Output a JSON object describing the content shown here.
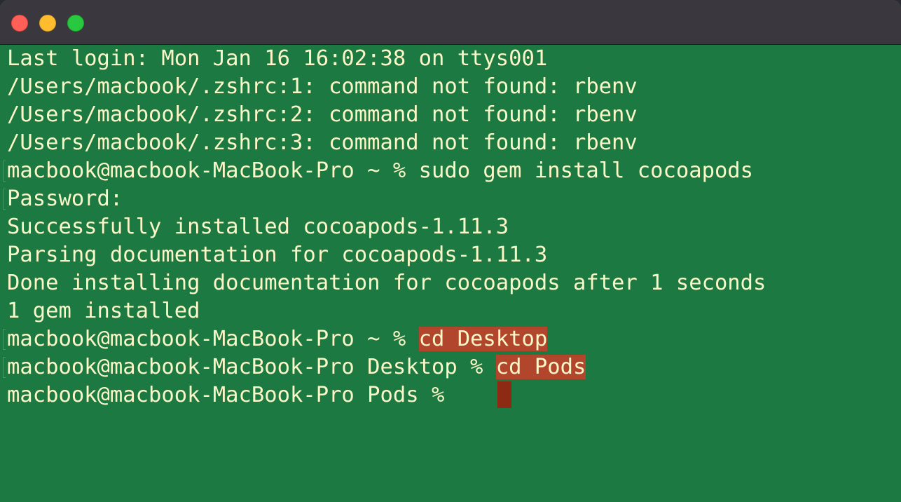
{
  "window": {
    "buttons": {
      "close": "close-button",
      "minimize": "minimize-button",
      "zoom": "zoom-button"
    }
  },
  "terminal": {
    "lines": [
      {
        "text": "Last login: Mon Jan 16 16:02:38 on ttys001"
      },
      {
        "text": "/Users/macbook/.zshrc:1: command not found: rbenv"
      },
      {
        "text": "/Users/macbook/.zshrc:2: command not found: rbenv"
      },
      {
        "text": "/Users/macbook/.zshrc:3: command not found: rbenv"
      },
      {
        "prompt": "macbook@macbook-MacBook-Pro ~ % ",
        "command": "sudo gem install cocoapods"
      },
      {
        "text": "Password:"
      },
      {
        "text": "Successfully installed cocoapods-1.11.3"
      },
      {
        "text": "Parsing documentation for cocoapods-1.11.3"
      },
      {
        "text": "Done installing documentation for cocoapods after 1 seconds"
      },
      {
        "text": "1 gem installed"
      },
      {
        "prompt": "macbook@macbook-MacBook-Pro ~ % ",
        "command": "cd Desktop"
      },
      {
        "prompt": "macbook@macbook-MacBook-Pro Desktop % ",
        "command": "cd Pods"
      },
      {
        "prompt": "macbook@macbook-MacBook-Pro Pods % ",
        "command": ""
      }
    ]
  },
  "colors": {
    "background": "#1c7942",
    "foreground": "#fbf6c8",
    "highlight": "#b2462d",
    "cursor": "#8c2a13",
    "titlebar": "#3a383e"
  }
}
